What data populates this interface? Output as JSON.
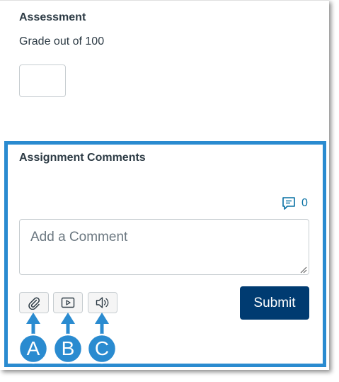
{
  "assessment": {
    "title": "Assessment",
    "grade_label": "Grade out of 100",
    "grade_value": ""
  },
  "comments": {
    "title": "Assignment Comments",
    "count": "0",
    "placeholder": "Add a Comment",
    "submit_label": "Submit"
  },
  "toolbar": [
    {
      "icon": "paperclip-icon",
      "purpose": "attach file"
    },
    {
      "icon": "play-video-icon",
      "purpose": "media comment"
    },
    {
      "icon": "speaker-icon",
      "purpose": "audio comment"
    }
  ],
  "callouts": [
    "A",
    "B",
    "C"
  ],
  "colors": {
    "highlight_border": "#2a8bd0",
    "callout_fill": "#2a8bd0",
    "submit_bg": "#003b71",
    "link_blue": "#0770a3",
    "text": "#2d3b45"
  }
}
